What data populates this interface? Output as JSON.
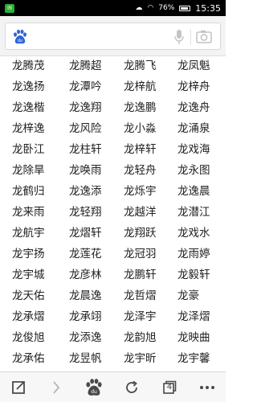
{
  "status_bar": {
    "battery_percent": "76%",
    "time": "15:35",
    "notification_icon": "wechat-icon"
  },
  "search": {
    "placeholder": ""
  },
  "names": [
    [
      "龙腾茂",
      "龙腾超",
      "龙腾飞",
      "龙凤魁"
    ],
    [
      "龙逸扬",
      "龙潭吟",
      "龙梓航",
      "龙梓舟"
    ],
    [
      "龙逸楷",
      "龙逸翔",
      "龙逸鹏",
      "龙逸舟"
    ],
    [
      "龙梓逸",
      "龙风险",
      "龙小淼",
      "龙涌泉"
    ],
    [
      "龙卧江",
      "龙柱轩",
      "龙梓轩",
      "龙戏海"
    ],
    [
      "龙除旱",
      "龙唤雨",
      "龙轻舟",
      "龙永图"
    ],
    [
      "龙鹤归",
      "龙逸添",
      "龙烁宇",
      "龙逸晨"
    ],
    [
      "龙来雨",
      "龙轻翔",
      "龙越洋",
      "龙潜江"
    ],
    [
      "龙航宇",
      "龙熠轩",
      "龙翔跃",
      "龙戏水"
    ],
    [
      "龙宇扬",
      "龙莲花",
      "龙冠羽",
      "龙雨婷"
    ],
    [
      "龙宇城",
      "龙彦林",
      "龙鹏轩",
      "龙毅轩"
    ],
    [
      "龙天佑",
      "龙晨逸",
      "龙哲熠",
      "龙豪"
    ],
    [
      "龙承熠",
      "龙承翊",
      "龙泽宇",
      "龙泽熠"
    ],
    [
      "龙俊旭",
      "龙添逸",
      "龙韵旭",
      "龙映曲"
    ],
    [
      "龙承佑",
      "龙昱帆",
      "龙宇昕",
      "龙宇馨"
    ]
  ],
  "bottom_bar": {
    "tabs_count": "4"
  }
}
